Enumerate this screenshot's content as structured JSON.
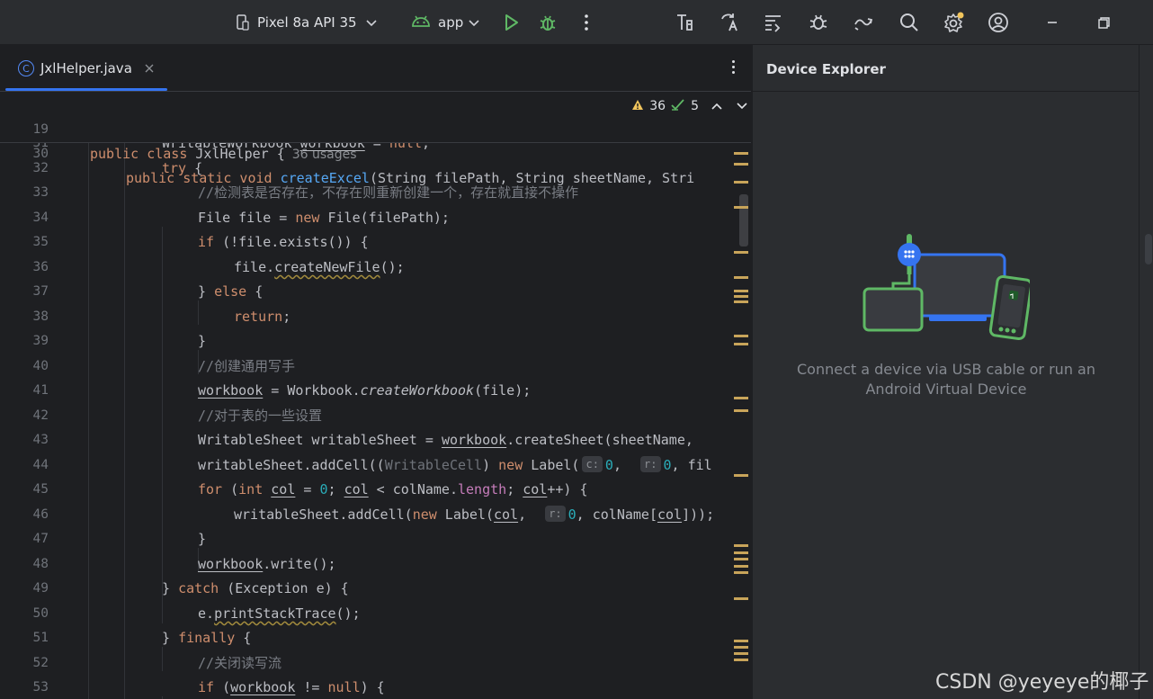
{
  "toolbar": {
    "device": "Pixel 8a API 35",
    "config": "app"
  },
  "tab": {
    "filename": "JxlHelper.java",
    "icon_letter": "C"
  },
  "inspections": {
    "warnings": "36",
    "weak": "5"
  },
  "sticky": {
    "line19": "19",
    "line30": "30",
    "usages": "36 usages"
  },
  "code_lines": [
    {
      "n": "31"
    },
    {
      "n": "32"
    },
    {
      "n": "33"
    },
    {
      "n": "34"
    },
    {
      "n": "35"
    },
    {
      "n": "36"
    },
    {
      "n": "37"
    },
    {
      "n": "38"
    },
    {
      "n": "39"
    },
    {
      "n": "40"
    },
    {
      "n": "41"
    },
    {
      "n": "42"
    },
    {
      "n": "43"
    },
    {
      "n": "44"
    },
    {
      "n": "45"
    },
    {
      "n": "46"
    },
    {
      "n": "47"
    },
    {
      "n": "48"
    },
    {
      "n": "49"
    },
    {
      "n": "50"
    },
    {
      "n": "51"
    },
    {
      "n": "52"
    },
    {
      "n": "53"
    }
  ],
  "device_explorer": {
    "title": "Device Explorer",
    "message": "Connect a device via USB cable or run an Android Virtual Device"
  },
  "watermark": "CSDN @yeyeye的椰子",
  "colors": {
    "accent": "#3574f0",
    "keyword": "#cf8e6d",
    "function": "#56a8f5",
    "comment": "#7a7e85",
    "number": "#2aacb8",
    "warning": "#f2c55c",
    "success": "#5fb865"
  },
  "icons": [
    "device-icon",
    "chevron-down-icon",
    "android-icon",
    "run-icon",
    "debug-icon",
    "more-icon",
    "profiler-icon",
    "translate-icon",
    "logcat-icon",
    "bug-search-icon",
    "sync-icon",
    "search-icon",
    "settings-icon",
    "account-icon",
    "minimize-icon",
    "restore-icon",
    "close-tab-icon",
    "warning-icon",
    "check-icon",
    "chevron-up-icon"
  ]
}
